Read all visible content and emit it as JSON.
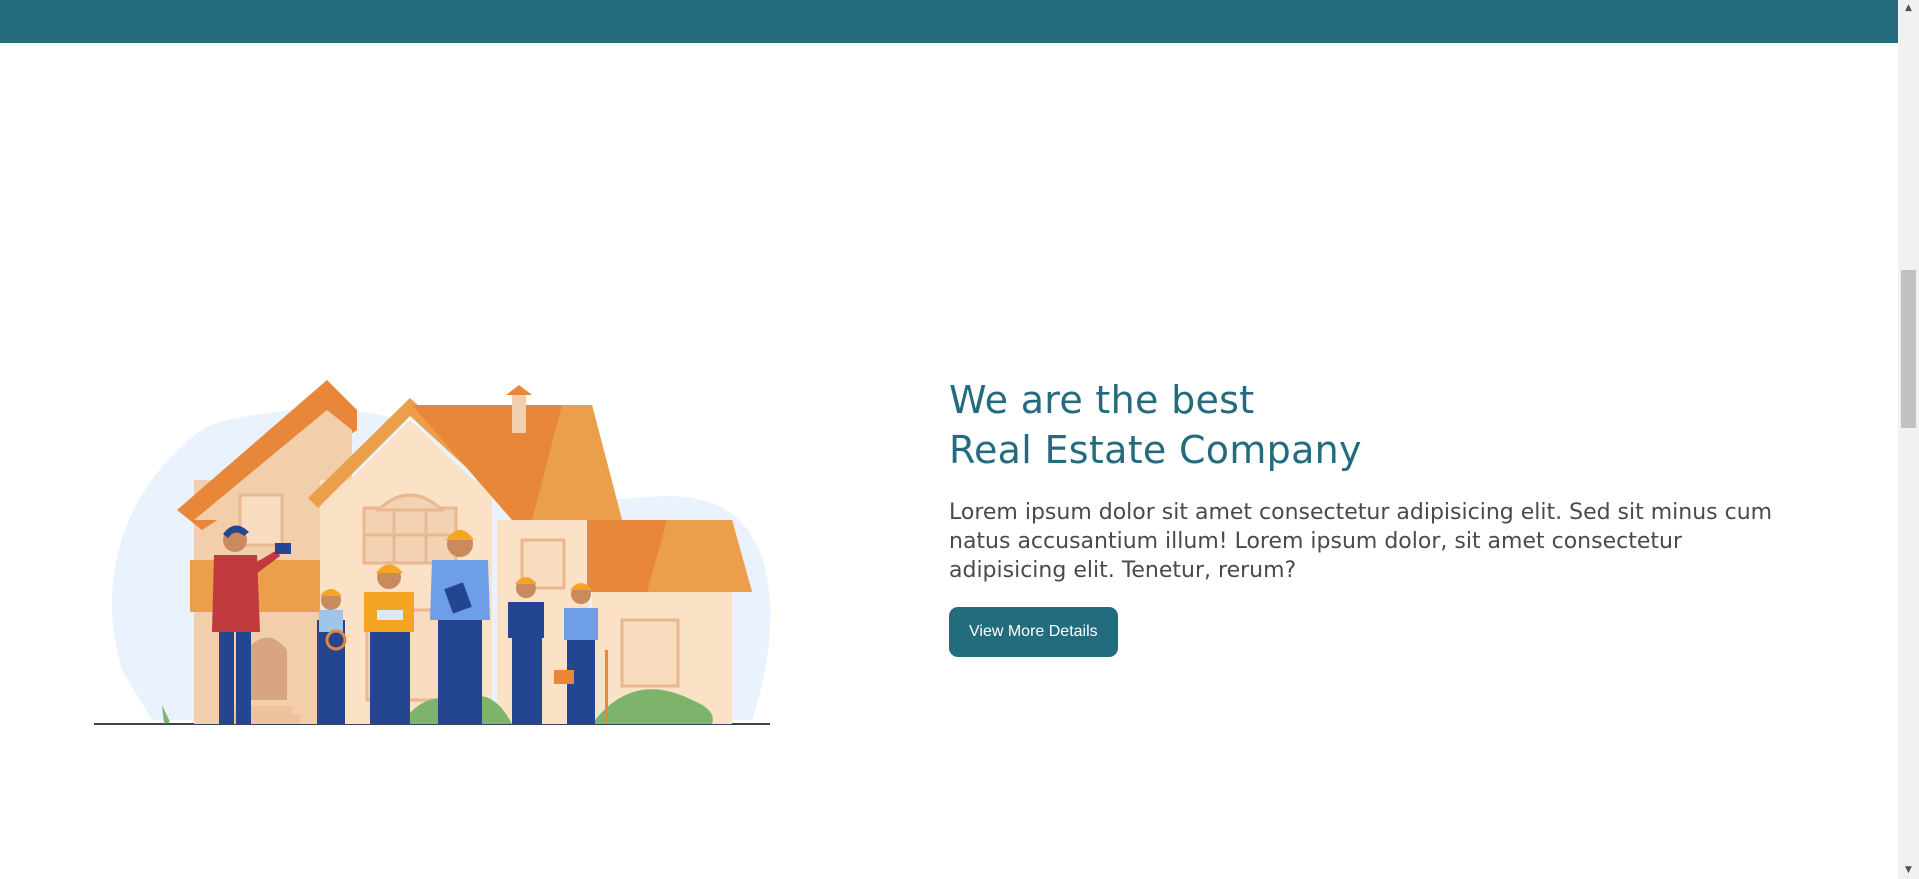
{
  "hero": {
    "heading_line1": "We are the best",
    "heading_line2": "Real Estate Company",
    "description": "Lorem ipsum dolor sit amet consectetur adipisicing elit. Sed sit minus cum natus accusantium illum! Lorem ipsum dolor, sit amet consectetur adipisicing elit. Tenetur, rerum?",
    "cta_label": "View More Details"
  },
  "scrollbar": {
    "up_icon": "▲",
    "down_icon": "▼"
  },
  "colors": {
    "brand": "#236c7d",
    "text": "#4a4a4a",
    "roof_orange": "#e8873a",
    "wall_peach": "#f6d5b4"
  }
}
